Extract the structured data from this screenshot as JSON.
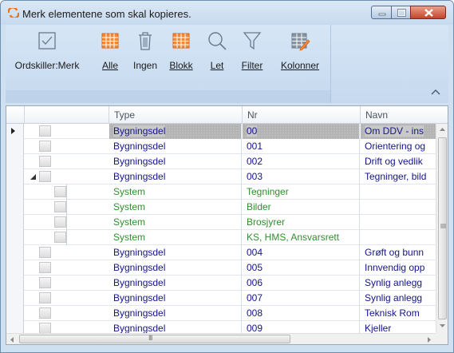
{
  "window": {
    "title": "Merk elementene som skal kopieres.",
    "accent_color": "#e8731a"
  },
  "ribbon": {
    "buttons": [
      {
        "id": "ordskiller",
        "label": "Ordskiller:Merk",
        "icon": "checkbox-icon"
      },
      {
        "id": "alle",
        "label": "Alle",
        "icon": "grid-orange-icon"
      },
      {
        "id": "ingen",
        "label": "Ingen",
        "icon": "trash-icon"
      },
      {
        "id": "blokk",
        "label": "Blokk",
        "icon": "grid-orange-icon"
      },
      {
        "id": "let",
        "label": "Let",
        "icon": "search-icon"
      },
      {
        "id": "filter",
        "label": "Filter",
        "icon": "filter-icon"
      },
      {
        "id": "kolonner",
        "label": "Kolonner",
        "icon": "columns-edit-icon"
      }
    ]
  },
  "grid": {
    "columns": [
      "Type",
      "Nr",
      "Navn"
    ],
    "rows": [
      {
        "type": "Bygningsdel",
        "nr": "00",
        "name": "Om DDV - ins",
        "level": 0,
        "kind": "bd",
        "selected": true,
        "current": true
      },
      {
        "type": "Bygningsdel",
        "nr": "001",
        "name": "Orientering og",
        "level": 0,
        "kind": "bd"
      },
      {
        "type": "Bygningsdel",
        "nr": "002",
        "name": "Drift og vedlik",
        "level": 0,
        "kind": "bd"
      },
      {
        "type": "Bygningsdel",
        "nr": "003",
        "name": "Tegninger, bild",
        "level": 0,
        "kind": "bd",
        "expanded": true
      },
      {
        "type": "System",
        "nr": "Tegninger",
        "name": "",
        "level": 1,
        "kind": "sys"
      },
      {
        "type": "System",
        "nr": "Bilder",
        "name": "",
        "level": 1,
        "kind": "sys"
      },
      {
        "type": "System",
        "nr": "Brosjyrer",
        "name": "",
        "level": 1,
        "kind": "sys"
      },
      {
        "type": "System",
        "nr": "KS, HMS, Ansvarsrett",
        "name": "",
        "level": 1,
        "kind": "sys"
      },
      {
        "type": "Bygningsdel",
        "nr": "004",
        "name": "Grøft og bunn",
        "level": 0,
        "kind": "bd"
      },
      {
        "type": "Bygningsdel",
        "nr": "005",
        "name": "Innvendig opp",
        "level": 0,
        "kind": "bd"
      },
      {
        "type": "Bygningsdel",
        "nr": "006",
        "name": "Synlig anlegg",
        "level": 0,
        "kind": "bd"
      },
      {
        "type": "Bygningsdel",
        "nr": "007",
        "name": "Synlig anlegg",
        "level": 0,
        "kind": "bd"
      },
      {
        "type": "Bygningsdel",
        "nr": "008",
        "name": "Teknisk Rom",
        "level": 0,
        "kind": "bd"
      },
      {
        "type": "Bygningsdel",
        "nr": "009",
        "name": "Kjeller",
        "level": 0,
        "kind": "bd"
      }
    ]
  },
  "scrollbar": {
    "horizontal_thumb_glyph": "III"
  }
}
